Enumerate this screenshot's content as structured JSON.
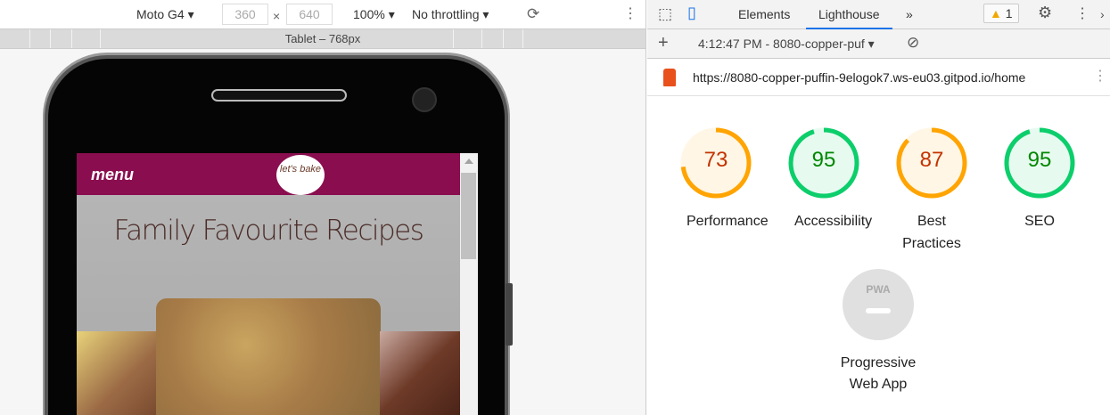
{
  "device_toolbar": {
    "device": "Moto G4",
    "width": "360",
    "times": "×",
    "height": "640",
    "zoom": "100%",
    "throttling": "No throttling"
  },
  "ruler": {
    "label": "Tablet – 768px"
  },
  "site": {
    "menu_label": "menu",
    "logo_text": "let's bake",
    "title": "Family Favourite Recipes"
  },
  "devtools": {
    "tabs": [
      {
        "label": "Elements"
      },
      {
        "label": "Lighthouse"
      }
    ],
    "warnings": "1",
    "report_select": "4:12:47 PM - 8080-copper-puf",
    "url": "https://8080-copper-puffin-9elogok7.ws-eu03.gitpod.io/home"
  },
  "lighthouse": {
    "categories": [
      {
        "label": "Performance",
        "score": 73,
        "color": "#ffa400"
      },
      {
        "label": "Accessibility",
        "score": 95,
        "color": "#0cce6b"
      },
      {
        "label": "Best Practices",
        "score": 87,
        "color": "#ffa400"
      },
      {
        "label": "SEO",
        "score": 95,
        "color": "#0cce6b"
      }
    ],
    "pwa": {
      "badge": "PWA",
      "label": "Progressive Web App"
    }
  }
}
